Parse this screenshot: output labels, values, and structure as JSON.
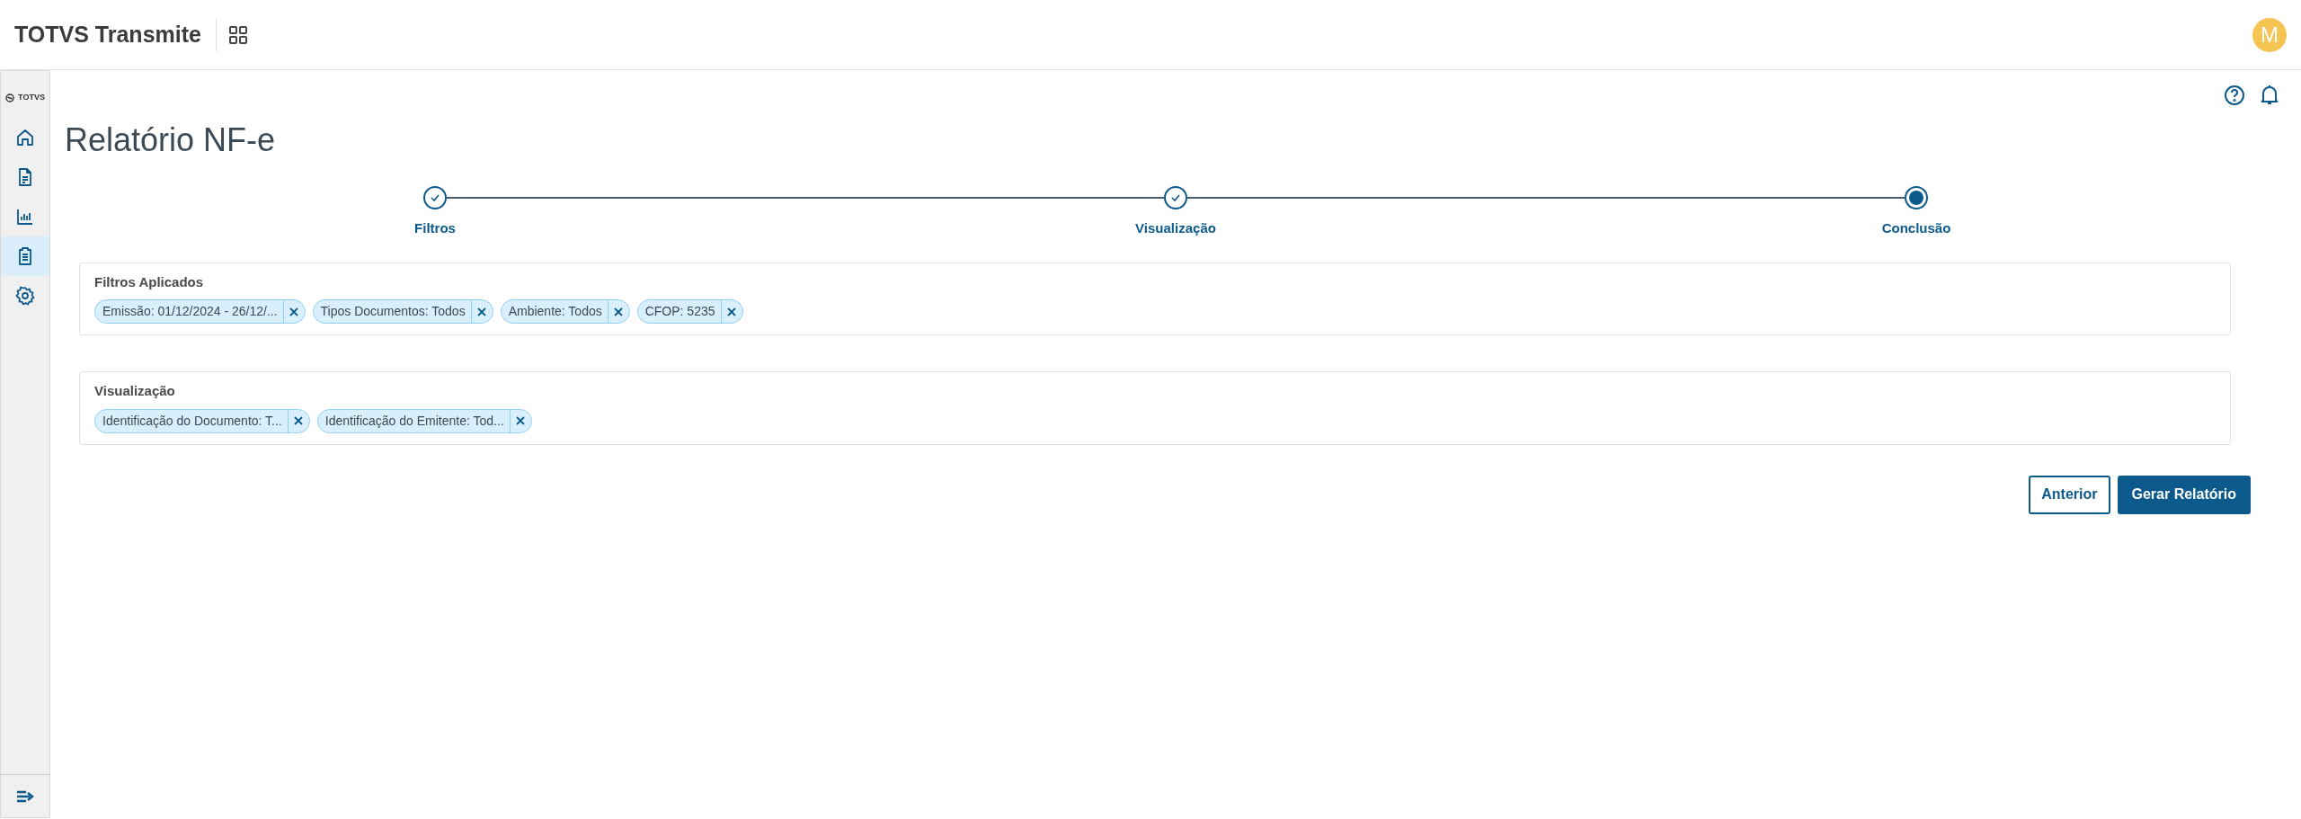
{
  "header": {
    "title": "TOTVS Transmite",
    "avatar": "M"
  },
  "sidebar": {
    "logo": "TOTVS",
    "items": [
      {
        "selected": false
      },
      {
        "selected": false
      },
      {
        "selected": false
      },
      {
        "selected": true
      },
      {
        "selected": false
      }
    ]
  },
  "page": {
    "title": "Relatório NF-e"
  },
  "steps": [
    {
      "label": "Filtros",
      "completed": true
    },
    {
      "label": "Visualização",
      "completed": true
    },
    {
      "label": "Conclusão",
      "completed": false
    }
  ],
  "panels": [
    {
      "title": "Filtros Aplicados",
      "chips": [
        "Emissão: 01/12/2024 - 26/12/...",
        "Tipos Documentos: Todos",
        "Ambiente: Todos",
        "CFOP: 5235"
      ]
    },
    {
      "title": "Visualização",
      "chips": [
        "Identificação do Documento: T...",
        "Identificação do Emitente: Tod..."
      ]
    }
  ],
  "buttons": [
    {
      "label": "Anterior",
      "kind": "secondary"
    },
    {
      "label": "Gerar Relatório",
      "kind": "primary"
    }
  ]
}
